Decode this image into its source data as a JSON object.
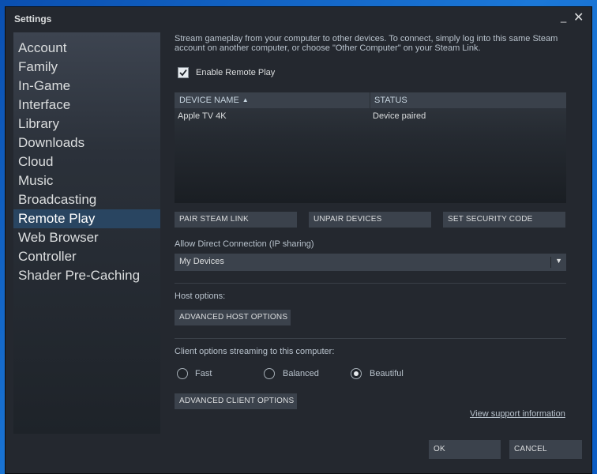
{
  "window": {
    "title": "Settings",
    "minimize_glyph": "_",
    "close_glyph": "✕"
  },
  "sidebar": {
    "items": [
      {
        "label": "Account"
      },
      {
        "label": "Family"
      },
      {
        "label": "In-Game"
      },
      {
        "label": "Interface"
      },
      {
        "label": "Library"
      },
      {
        "label": "Downloads"
      },
      {
        "label": "Cloud"
      },
      {
        "label": "Music"
      },
      {
        "label": "Broadcasting"
      },
      {
        "label": "Remote Play",
        "active": true
      },
      {
        "label": "Web Browser"
      },
      {
        "label": "Controller"
      },
      {
        "label": "Shader Pre-Caching"
      }
    ]
  },
  "remote_play": {
    "description_line1": "Stream gameplay from your computer to other devices. To connect, simply log into this same Steam",
    "description_line2": "account on another computer, or choose \"Other Computer\" on your Steam Link.",
    "enable_label": "Enable Remote Play",
    "enable_checked": true,
    "table": {
      "columns": {
        "name": "DEVICE NAME",
        "status": "STATUS"
      },
      "sort_icon": "▲",
      "rows": [
        {
          "name": "Apple TV 4K",
          "status": "Device paired"
        }
      ]
    },
    "buttons": {
      "pair": "PAIR STEAM LINK",
      "unpair": "UNPAIR DEVICES",
      "security": "SET SECURITY CODE"
    },
    "direct_connection": {
      "label": "Allow Direct Connection (IP sharing)",
      "value": "My Devices",
      "arrow": "▼"
    },
    "host": {
      "label": "Host options:",
      "button": "ADVANCED HOST OPTIONS"
    },
    "client": {
      "label": "Client options streaming to this computer:",
      "options": [
        {
          "label": "Fast",
          "selected": false
        },
        {
          "label": "Balanced",
          "selected": false
        },
        {
          "label": "Beautiful",
          "selected": true
        }
      ],
      "button": "ADVANCED CLIENT OPTIONS"
    },
    "support_link": "View support information"
  },
  "footer": {
    "ok": "OK",
    "cancel": "CANCEL"
  }
}
